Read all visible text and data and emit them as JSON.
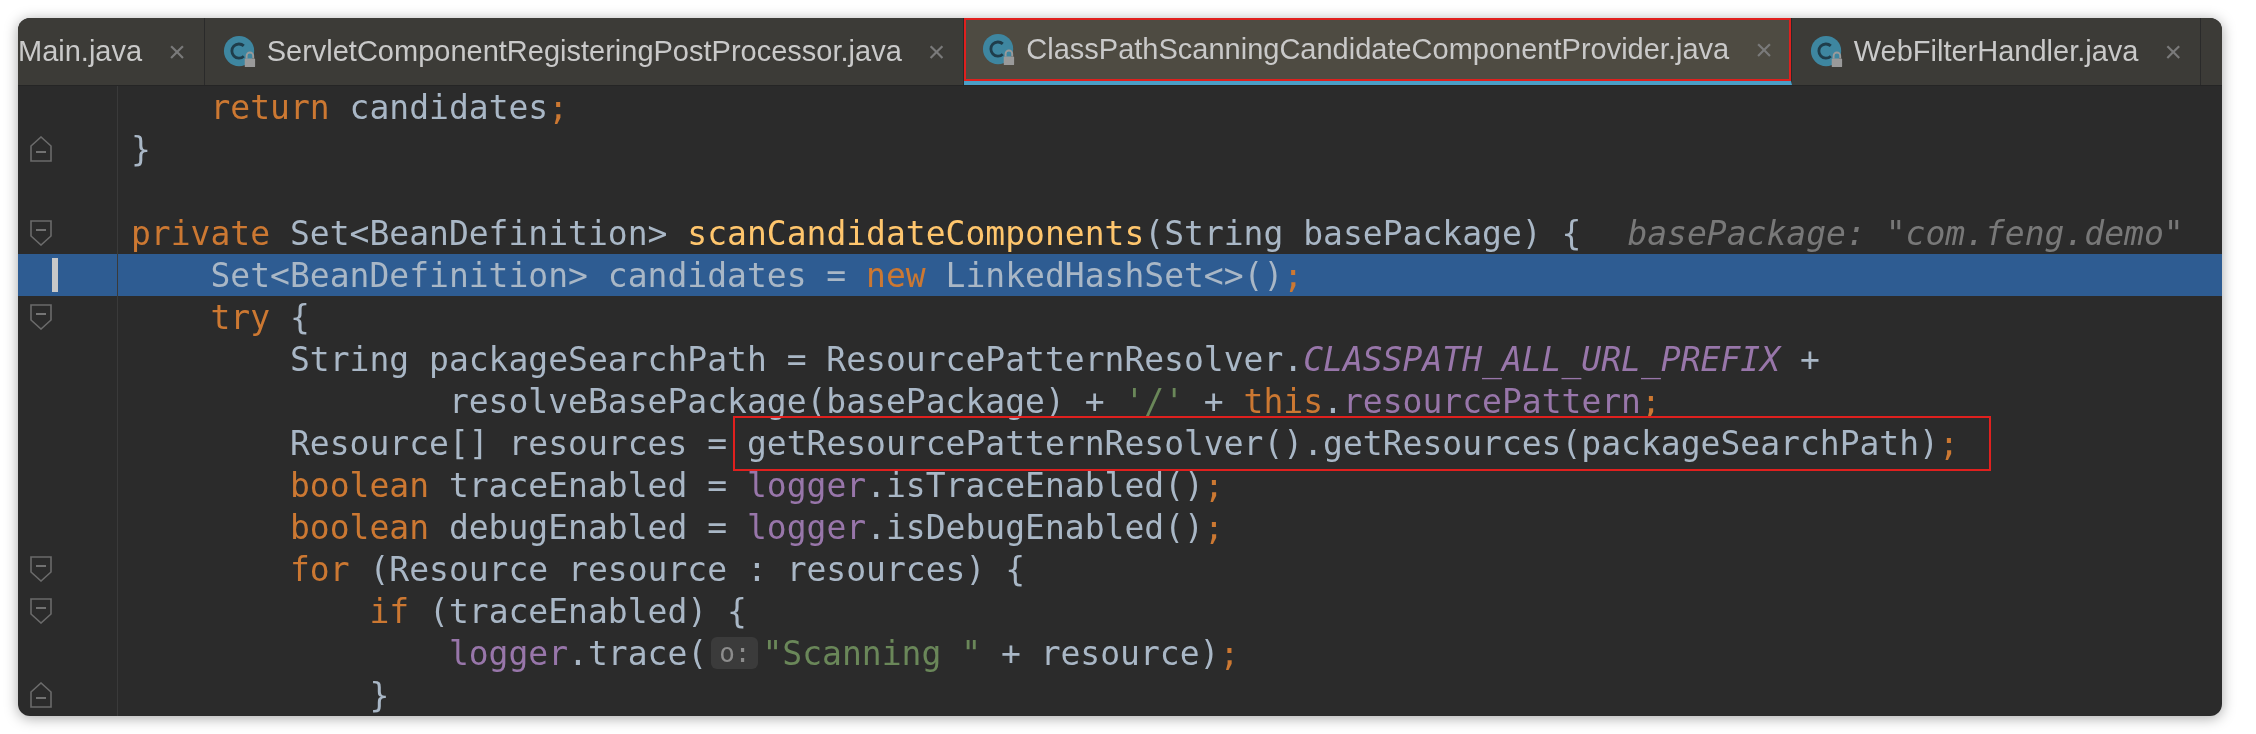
{
  "tabs": [
    {
      "label": "Main.java",
      "icon": false,
      "selected": false,
      "boxed": false,
      "close": "×"
    },
    {
      "label": "ServletComponentRegisteringPostProcessor.java",
      "icon": true,
      "selected": false,
      "boxed": false,
      "close": "×"
    },
    {
      "label": "ClassPathScanningCandidateComponentProvider.java",
      "icon": true,
      "selected": true,
      "boxed": true,
      "close": "×"
    },
    {
      "label": "WebFilterHandler.java",
      "icon": true,
      "selected": false,
      "boxed": false,
      "close": "×"
    }
  ],
  "editor": {
    "lines": [
      {
        "selected": false,
        "tokens": [
          {
            "kind": "keyword",
            "text": "    return"
          },
          {
            "kind": "plain",
            "text": " candidates"
          },
          {
            "kind": "keyword",
            "text": ";"
          }
        ]
      },
      {
        "selected": false,
        "fold_end": true,
        "tokens": [
          {
            "kind": "plain",
            "text": "}"
          }
        ]
      },
      {
        "selected": false
      },
      {
        "selected": false,
        "fold_start": true,
        "tokens": [
          {
            "kind": "keyword",
            "text": "private"
          },
          {
            "kind": "plain",
            "text": " Set<BeanDefinition> "
          },
          {
            "kind": "decl",
            "text": "scanCandidateComponents"
          },
          {
            "kind": "plain",
            "text": "(String basePackage) {"
          },
          {
            "kind": "hint",
            "text": "basePackage: \"com.feng.demo\""
          }
        ]
      },
      {
        "selected": true,
        "tokens": [
          {
            "kind": "plain",
            "text": "    Set<BeanDefinition> candidates = "
          },
          {
            "kind": "keyword",
            "text": "new"
          },
          {
            "kind": "plain",
            "text": " LinkedHashSet<>()"
          },
          {
            "kind": "keyword",
            "text": ";"
          }
        ]
      },
      {
        "selected": false,
        "fold_start": true,
        "tokens": [
          {
            "kind": "keyword",
            "text": "    try"
          },
          {
            "kind": "plain",
            "text": " {"
          }
        ]
      },
      {
        "selected": false,
        "tokens": [
          {
            "kind": "plain",
            "text": "        String packageSearchPath = ResourcePatternResolver."
          },
          {
            "kind": "constant",
            "text": "CLASSPATH_ALL_URL_PREFIX"
          },
          {
            "kind": "plain",
            "text": " +"
          }
        ]
      },
      {
        "selected": false,
        "tokens": [
          {
            "kind": "plain",
            "text": "                resolveBasePackage(basePackage) + "
          },
          {
            "kind": "string",
            "text": "'/'"
          },
          {
            "kind": "plain",
            "text": " + "
          },
          {
            "kind": "keyword",
            "text": "this"
          },
          {
            "kind": "plain",
            "text": "."
          },
          {
            "kind": "field",
            "text": "resourcePattern"
          },
          {
            "kind": "keyword",
            "text": ";"
          }
        ]
      },
      {
        "selected": false,
        "tokens": [
          {
            "kind": "plain",
            "text": "        Resource[] resources = "
          },
          {
            "kind": "plain",
            "text": "getResourcePatternResolver().getResources(packageSearchPath)",
            "boxed": true
          },
          {
            "kind": "keyword",
            "text": ";",
            "boxed": true
          }
        ]
      },
      {
        "selected": false,
        "tokens": [
          {
            "kind": "keyword",
            "text": "        boolean"
          },
          {
            "kind": "plain",
            "text": " traceEnabled = "
          },
          {
            "kind": "field",
            "text": "logger"
          },
          {
            "kind": "plain",
            "text": ".isTraceEnabled()"
          },
          {
            "kind": "keyword",
            "text": ";"
          }
        ]
      },
      {
        "selected": false,
        "tokens": [
          {
            "kind": "keyword",
            "text": "        boolean"
          },
          {
            "kind": "plain",
            "text": " debugEnabled = "
          },
          {
            "kind": "field",
            "text": "logger"
          },
          {
            "kind": "plain",
            "text": ".isDebugEnabled()"
          },
          {
            "kind": "keyword",
            "text": ";"
          }
        ]
      },
      {
        "selected": false,
        "fold_start": true,
        "tokens": [
          {
            "kind": "keyword",
            "text": "        for"
          },
          {
            "kind": "plain",
            "text": " (Resource resource : resources) {"
          }
        ]
      },
      {
        "selected": false,
        "fold_start": true,
        "tokens": [
          {
            "kind": "keyword",
            "text": "            if"
          },
          {
            "kind": "plain",
            "text": " (traceEnabled) {"
          }
        ]
      },
      {
        "selected": false,
        "tokens": [
          {
            "kind": "field",
            "text": "                logger"
          },
          {
            "kind": "plain",
            "text": ".trace("
          },
          {
            "kind": "param",
            "text": "o:"
          },
          {
            "kind": "string",
            "text": "\"Scanning \""
          },
          {
            "kind": "plain",
            "text": " + resource)"
          },
          {
            "kind": "keyword",
            "text": ";"
          }
        ]
      },
      {
        "selected": false,
        "fold_end": true,
        "tokens": [
          {
            "kind": "plain",
            "text": "            }"
          }
        ]
      }
    ]
  }
}
